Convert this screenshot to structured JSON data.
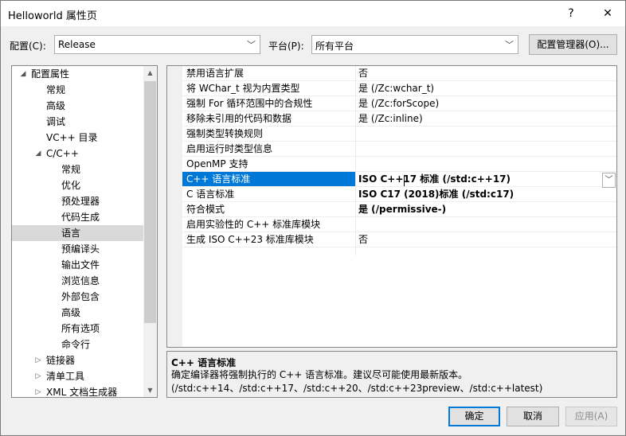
{
  "window": {
    "title": "Helloworld 属性页",
    "help_btn": "?",
    "close_btn": "✕"
  },
  "toolbar": {
    "config_label": "配置(C):",
    "config_value": "Release",
    "platform_label": "平台(P):",
    "platform_value": "所有平台",
    "config_manager_btn": "配置管理器(O)..."
  },
  "tree": {
    "items": [
      {
        "label": "配置属性",
        "twisty": "◢"
      },
      {
        "label": "常规"
      },
      {
        "label": "高级"
      },
      {
        "label": "调试"
      },
      {
        "label": "VC++ 目录"
      },
      {
        "label": "C/C++",
        "twisty": "◢"
      },
      {
        "label": "常规"
      },
      {
        "label": "优化"
      },
      {
        "label": "预处理器"
      },
      {
        "label": "代码生成"
      },
      {
        "label": "语言"
      },
      {
        "label": "预编译头"
      },
      {
        "label": "输出文件"
      },
      {
        "label": "浏览信息"
      },
      {
        "label": "外部包含"
      },
      {
        "label": "高级"
      },
      {
        "label": "所有选项"
      },
      {
        "label": "命令行"
      },
      {
        "label": "链接器",
        "twisty": "▷"
      },
      {
        "label": "清单工具",
        "twisty": "▷"
      },
      {
        "label": "XML 文档生成器",
        "twisty": "▷"
      }
    ],
    "selected": "语言"
  },
  "properties": [
    {
      "name": "禁用语言扩展",
      "value": "否"
    },
    {
      "name": "将 WChar_t 视为内置类型",
      "value": "是 (/Zc:wchar_t)"
    },
    {
      "name": "强制 For 循环范围中的合规性",
      "value": "是 (/Zc:forScope)"
    },
    {
      "name": "移除未引用的代码和数据",
      "value": "是 (/Zc:inline)"
    },
    {
      "name": "强制类型转换规则",
      "value": ""
    },
    {
      "name": "启用运行时类型信息",
      "value": ""
    },
    {
      "name": "OpenMP 支持",
      "value": ""
    },
    {
      "name": "C++ 语言标准",
      "value": "ISO C++17 标准 (/std:c++17)"
    },
    {
      "name": "C 语言标准",
      "value": "ISO C17 (2018)标准 (/std:c17)"
    },
    {
      "name": "符合模式",
      "value": "是 (/permissive-)"
    },
    {
      "name": "启用实验性的 C++ 标准库模块",
      "value": ""
    },
    {
      "name": "生成 ISO C++23 标准库模块",
      "value": "否"
    }
  ],
  "description": {
    "title": "C++ 语言标准",
    "body": "确定编译器将强制执行的 C++ 语言标准。建议尽可能使用最新版本。(/std:c++14、/std:c++17、/std:c++20、/std:c++23preview、/std:c++latest)"
  },
  "buttons": {
    "ok": "确定",
    "cancel": "取消",
    "apply": "应用(A)"
  }
}
